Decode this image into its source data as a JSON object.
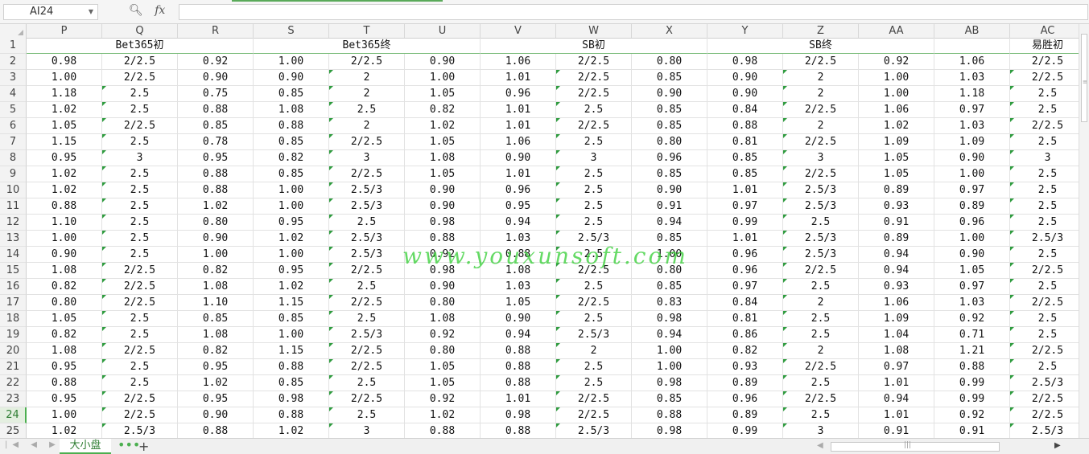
{
  "formula_bar": {
    "cell_ref": "AI24",
    "zoom_icon": "magnifier-icon",
    "fx_label": "fx",
    "formula": ""
  },
  "columns": [
    "P",
    "Q",
    "R",
    "S",
    "T",
    "U",
    "V",
    "W",
    "X",
    "Y",
    "Z",
    "AA",
    "AB",
    "AC"
  ],
  "row1": {
    "row_number": "1",
    "groups": [
      {
        "label": "Bet365初",
        "span": 3
      },
      {
        "label": "Bet365终",
        "span": 3
      },
      {
        "label": "SB初",
        "span": 3
      },
      {
        "label": "SB终",
        "span": 3
      },
      {
        "label": "",
        "span": 1
      },
      {
        "label": "易胜初",
        "span": 1
      }
    ]
  },
  "rows": [
    {
      "n": "2",
      "cells": [
        "0.98",
        "2/2.5",
        "0.92",
        "1.00",
        "2/2.5",
        "0.90",
        "1.06",
        "2/2.5",
        "0.80",
        "0.98",
        "2/2.5",
        "0.92",
        "1.06",
        "2/2.5"
      ]
    },
    {
      "n": "3",
      "cells": [
        "1.00",
        "2/2.5",
        "0.90",
        "0.90",
        "2",
        "1.00",
        "1.01",
        "2/2.5",
        "0.85",
        "0.90",
        "2",
        "1.00",
        "1.03",
        "2/2.5"
      ]
    },
    {
      "n": "4",
      "cells": [
        "1.18",
        "2.5",
        "0.75",
        "0.85",
        "2",
        "1.05",
        "0.96",
        "2/2.5",
        "0.90",
        "0.90",
        "2",
        "1.00",
        "1.18",
        "2.5"
      ]
    },
    {
      "n": "5",
      "cells": [
        "1.02",
        "2.5",
        "0.88",
        "1.08",
        "2.5",
        "0.82",
        "1.01",
        "2.5",
        "0.85",
        "0.84",
        "2/2.5",
        "1.06",
        "0.97",
        "2.5"
      ]
    },
    {
      "n": "6",
      "cells": [
        "1.05",
        "2/2.5",
        "0.85",
        "0.88",
        "2",
        "1.02",
        "1.01",
        "2/2.5",
        "0.85",
        "0.88",
        "2",
        "1.02",
        "1.03",
        "2/2.5"
      ]
    },
    {
      "n": "7",
      "cells": [
        "1.15",
        "2.5",
        "0.78",
        "0.85",
        "2/2.5",
        "1.05",
        "1.06",
        "2.5",
        "0.80",
        "0.81",
        "2/2.5",
        "1.09",
        "1.09",
        "2.5"
      ]
    },
    {
      "n": "8",
      "cells": [
        "0.95",
        "3",
        "0.95",
        "0.82",
        "3",
        "1.08",
        "0.90",
        "3",
        "0.96",
        "0.85",
        "3",
        "1.05",
        "0.90",
        "3"
      ]
    },
    {
      "n": "9",
      "cells": [
        "1.02",
        "2.5",
        "0.88",
        "0.85",
        "2/2.5",
        "1.05",
        "1.01",
        "2.5",
        "0.85",
        "0.85",
        "2/2.5",
        "1.05",
        "1.00",
        "2.5"
      ]
    },
    {
      "n": "10",
      "cells": [
        "1.02",
        "2.5",
        "0.88",
        "1.00",
        "2.5/3",
        "0.90",
        "0.96",
        "2.5",
        "0.90",
        "1.01",
        "2.5/3",
        "0.89",
        "0.97",
        "2.5"
      ]
    },
    {
      "n": "11",
      "cells": [
        "0.88",
        "2.5",
        "1.02",
        "1.00",
        "2.5/3",
        "0.90",
        "0.95",
        "2.5",
        "0.91",
        "0.97",
        "2.5/3",
        "0.93",
        "0.89",
        "2.5"
      ]
    },
    {
      "n": "12",
      "cells": [
        "1.10",
        "2.5",
        "0.80",
        "0.95",
        "2.5",
        "0.98",
        "0.94",
        "2.5",
        "0.94",
        "0.99",
        "2.5",
        "0.91",
        "0.96",
        "2.5"
      ]
    },
    {
      "n": "13",
      "cells": [
        "1.00",
        "2.5",
        "0.90",
        "1.02",
        "2.5/3",
        "0.88",
        "1.03",
        "2.5/3",
        "0.85",
        "1.01",
        "2.5/3",
        "0.89",
        "1.00",
        "2.5/3"
      ]
    },
    {
      "n": "14",
      "cells": [
        "0.90",
        "2.5",
        "1.00",
        "1.00",
        "2.5/3",
        "0.92",
        "0.88",
        "2.5",
        "1.00",
        "0.96",
        "2.5/3",
        "0.94",
        "0.90",
        "2.5"
      ]
    },
    {
      "n": "15",
      "cells": [
        "1.08",
        "2/2.5",
        "0.82",
        "0.95",
        "2/2.5",
        "0.98",
        "1.08",
        "2/2.5",
        "0.80",
        "0.96",
        "2/2.5",
        "0.94",
        "1.05",
        "2/2.5"
      ]
    },
    {
      "n": "16",
      "cells": [
        "0.82",
        "2/2.5",
        "1.08",
        "1.02",
        "2.5",
        "0.90",
        "1.03",
        "2.5",
        "0.85",
        "0.97",
        "2.5",
        "0.93",
        "0.97",
        "2.5"
      ]
    },
    {
      "n": "17",
      "cells": [
        "0.80",
        "2/2.5",
        "1.10",
        "1.15",
        "2/2.5",
        "0.80",
        "1.05",
        "2/2.5",
        "0.83",
        "0.84",
        "2",
        "1.06",
        "1.03",
        "2/2.5"
      ]
    },
    {
      "n": "18",
      "cells": [
        "1.05",
        "2.5",
        "0.85",
        "0.85",
        "2.5",
        "1.08",
        "0.90",
        "2.5",
        "0.98",
        "0.81",
        "2.5",
        "1.09",
        "0.92",
        "2.5"
      ]
    },
    {
      "n": "19",
      "cells": [
        "0.82",
        "2.5",
        "1.08",
        "1.00",
        "2.5/3",
        "0.92",
        "0.94",
        "2.5/3",
        "0.94",
        "0.86",
        "2.5",
        "1.04",
        "0.71",
        "2.5"
      ]
    },
    {
      "n": "20",
      "cells": [
        "1.08",
        "2/2.5",
        "0.82",
        "1.15",
        "2/2.5",
        "0.80",
        "0.88",
        "2",
        "1.00",
        "0.82",
        "2",
        "1.08",
        "1.21",
        "2/2.5"
      ]
    },
    {
      "n": "21",
      "cells": [
        "0.95",
        "2.5",
        "0.95",
        "0.88",
        "2/2.5",
        "1.05",
        "0.88",
        "2.5",
        "1.00",
        "0.93",
        "2/2.5",
        "0.97",
        "0.88",
        "2.5"
      ]
    },
    {
      "n": "22",
      "cells": [
        "0.88",
        "2.5",
        "1.02",
        "0.85",
        "2.5",
        "1.05",
        "0.88",
        "2.5",
        "0.98",
        "0.89",
        "2.5",
        "1.01",
        "0.99",
        "2.5/3"
      ]
    },
    {
      "n": "23",
      "cells": [
        "0.95",
        "2/2.5",
        "0.95",
        "0.98",
        "2/2.5",
        "0.92",
        "1.01",
        "2/2.5",
        "0.85",
        "0.96",
        "2/2.5",
        "0.94",
        "0.99",
        "2/2.5"
      ]
    },
    {
      "n": "24",
      "cells": [
        "1.00",
        "2/2.5",
        "0.90",
        "0.88",
        "2.5",
        "1.02",
        "0.98",
        "2/2.5",
        "0.88",
        "0.89",
        "2.5",
        "1.01",
        "0.92",
        "2/2.5"
      ]
    },
    {
      "n": "25",
      "cells": [
        "1.02",
        "2.5/3",
        "0.88",
        "1.02",
        "3",
        "0.88",
        "0.88",
        "2.5/3",
        "0.98",
        "0.99",
        "3",
        "0.91",
        "0.91",
        "2.5/3"
      ]
    }
  ],
  "watermark": "www.youxunsoft.com",
  "sheet_tab": "大小盘",
  "tab_more": "•••",
  "tab_add": "+",
  "accent_color": "#4caf50"
}
